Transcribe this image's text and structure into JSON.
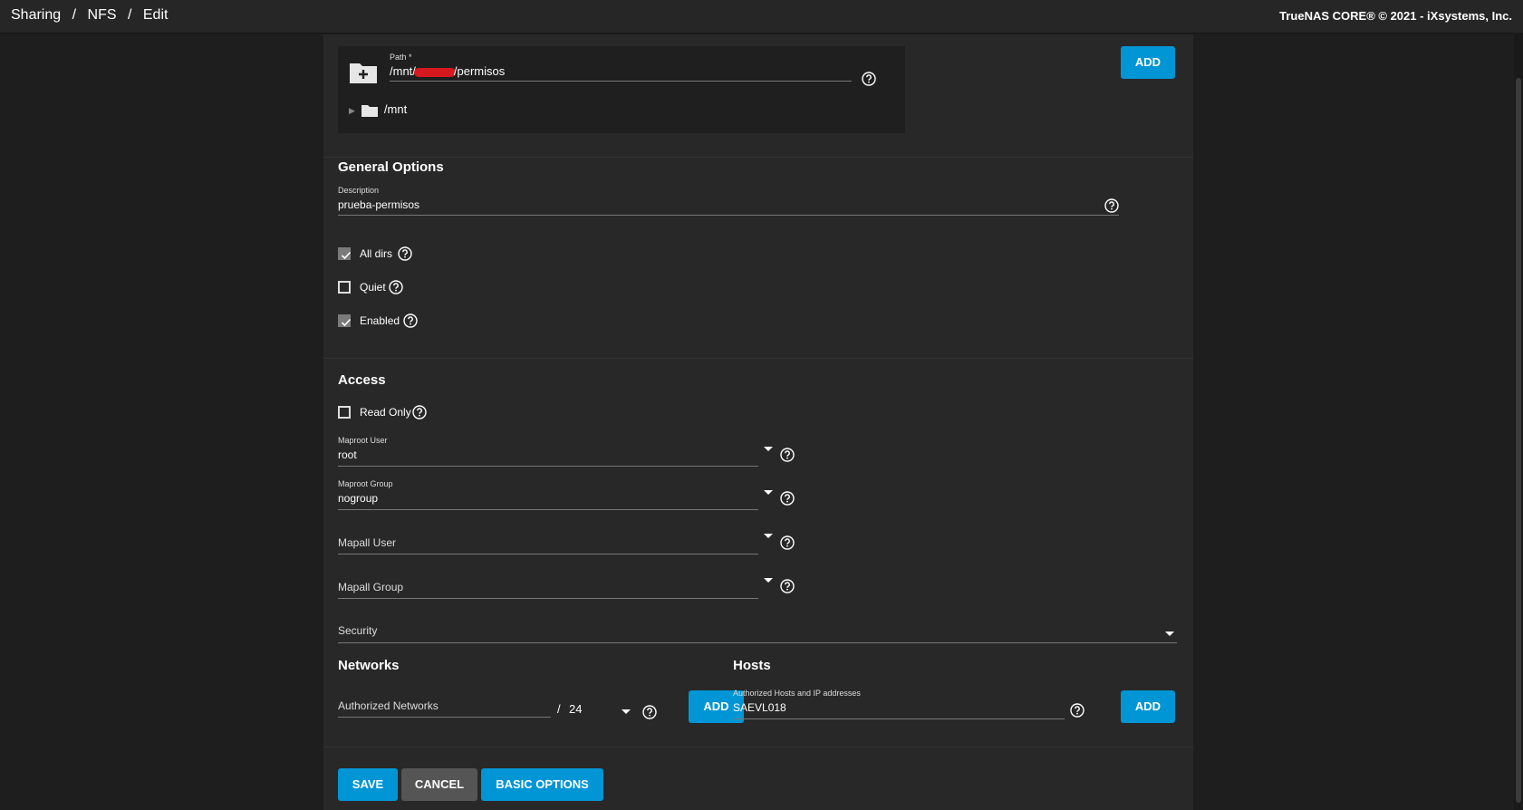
{
  "header": {
    "breadcrumb": [
      "Sharing",
      "NFS",
      "Edit"
    ],
    "separator": "/",
    "copyright": "TrueNAS CORE® © 2021 - iXsystems, Inc."
  },
  "path": {
    "label": "Path *",
    "value_prefix": "/mnt/",
    "value_suffix": "/permisos",
    "tree_root": "/mnt",
    "add_button": "ADD"
  },
  "general": {
    "title": "General Options",
    "description_label": "Description",
    "description_value": "prueba-permisos",
    "checkboxes": [
      {
        "label": "All dirs",
        "checked": true
      },
      {
        "label": "Quiet",
        "checked": false
      },
      {
        "label": "Enabled",
        "checked": true
      }
    ]
  },
  "access": {
    "title": "Access",
    "read_only": {
      "label": "Read Only",
      "checked": false
    },
    "maproot_user": {
      "label": "Maproot User",
      "value": "root"
    },
    "maproot_group": {
      "label": "Maproot Group",
      "value": "nogroup"
    },
    "mapall_user": {
      "placeholder": "Mapall User"
    },
    "mapall_group": {
      "placeholder": "Mapall Group"
    },
    "security": {
      "placeholder": "Security"
    }
  },
  "networks": {
    "title": "Networks",
    "placeholder": "Authorized Networks",
    "slash": "/",
    "mask": "24",
    "add_button": "ADD"
  },
  "hosts": {
    "title": "Hosts",
    "label": "Authorized Hosts and IP addresses",
    "value": "SAEVL018",
    "add_button": "ADD"
  },
  "actions": {
    "save": "SAVE",
    "cancel": "CANCEL",
    "basic_options": "BASIC OPTIONS"
  },
  "colors": {
    "accent": "#0095d5",
    "cancel": "#555555",
    "card": "#282828",
    "background": "#1e1e1e"
  },
  "icons": [
    "folder-plus-icon",
    "folder-icon",
    "help-icon",
    "checkmark-icon",
    "caret-down-icon",
    "expand-arrow-icon"
  ]
}
